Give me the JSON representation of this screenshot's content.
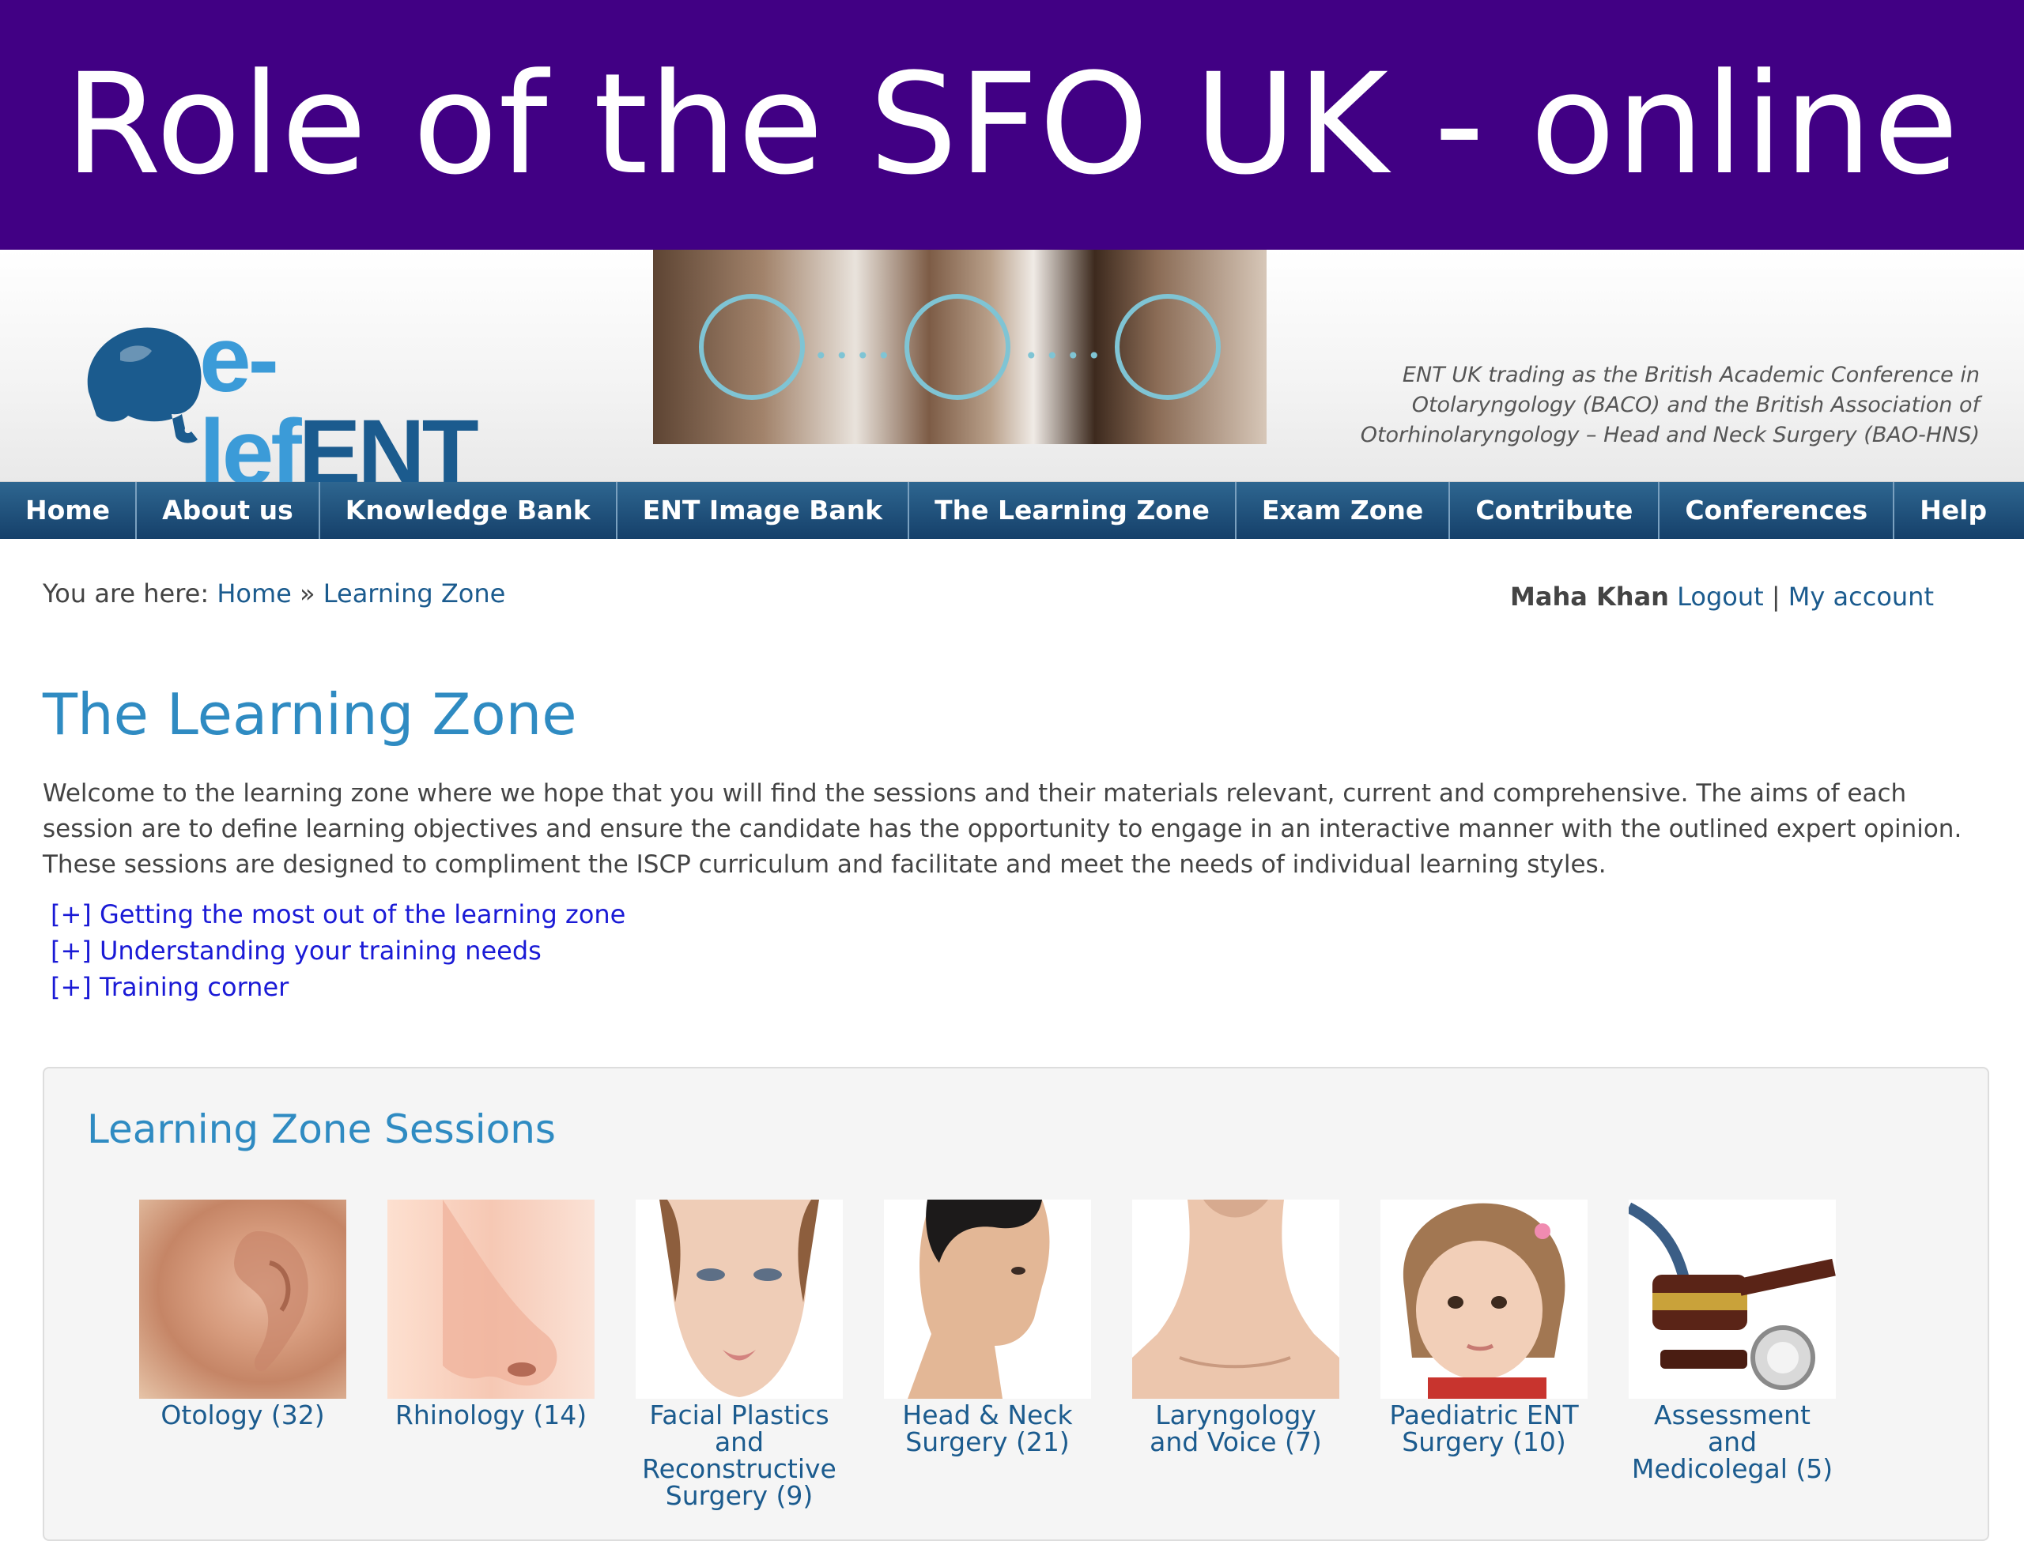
{
  "slide": {
    "title": "Role of the SFO UK - online"
  },
  "header": {
    "logo": {
      "text_left": "e-lef",
      "text_right": "ENT"
    },
    "org_lines": [
      "ENT UK trading as the British Academic Conference in",
      "Otolaryngology (BACO) and the British Association of",
      "Otorhinolaryngology – Head and Neck Surgery (BAO-HNS)"
    ]
  },
  "nav": {
    "items": [
      {
        "label": "Home"
      },
      {
        "label": "About us"
      },
      {
        "label": "Knowledge Bank"
      },
      {
        "label": "ENT Image Bank"
      },
      {
        "label": "The Learning Zone"
      },
      {
        "label": "Exam Zone"
      },
      {
        "label": "Contribute"
      },
      {
        "label": "Conferences"
      },
      {
        "label": "Help"
      }
    ]
  },
  "breadcrumb": {
    "prefix": "You are here:",
    "home": "Home",
    "separator": "»",
    "current": "Learning Zone"
  },
  "user": {
    "name": "Maha Khan",
    "logout": "Logout",
    "separator": "|",
    "account": "My account"
  },
  "page": {
    "title": "The Learning Zone",
    "intro": "Welcome to the learning zone where we hope that you will find the sessions and their materials relevant, current and comprehensive. The aims of each session are to define learning objectives and ensure the candidate has the opportunity to engage in an interactive manner with the outlined expert opinion. These sessions are designed to compliment the ISCP curriculum and facilitate and meet the needs of individual learning styles.",
    "toggles": [
      {
        "label": "[+] Getting the most out of the learning zone"
      },
      {
        "label": "[+] Understanding your training needs"
      },
      {
        "label": "[+] Training corner"
      }
    ]
  },
  "sessions": {
    "title": "Learning Zone Sessions",
    "items": [
      {
        "label": "Otology (32)",
        "image": "ear-photo"
      },
      {
        "label": "Rhinology (14)",
        "image": "nose-photo"
      },
      {
        "label": "Facial Plastics and Reconstructive Surgery (9)",
        "image": "face-photo"
      },
      {
        "label": "Head & Neck Surgery (21)",
        "image": "man-profile-photo"
      },
      {
        "label": "Laryngology and Voice (7)",
        "image": "neck-photo"
      },
      {
        "label": "Paediatric ENT Surgery (10)",
        "image": "child-photo"
      },
      {
        "label": "Assessment and Medicolegal (5)",
        "image": "gavel-stethoscope-photo"
      }
    ]
  },
  "colors": {
    "slide_band": "#410084",
    "nav_bar": "#1f5079",
    "heading_blue": "#2f8bc2",
    "link_blue": "#1b5b8e",
    "toggle_link": "#1a1ad6"
  }
}
